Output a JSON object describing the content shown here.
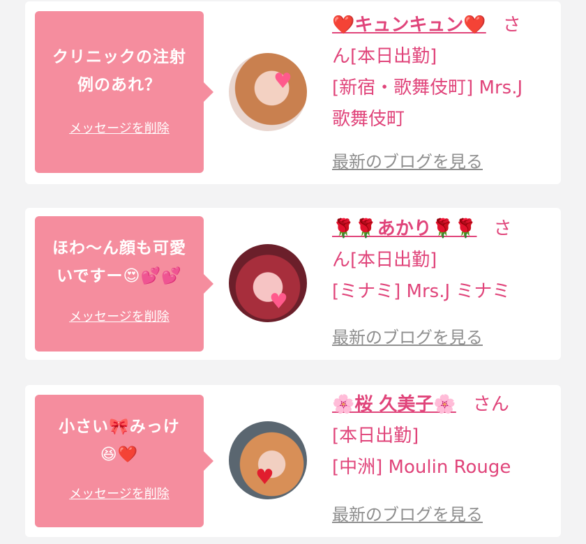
{
  "messages": [
    {
      "message_line1": "クリニックの注射",
      "message_line2": "例のあれ？",
      "delete_label": "メッセージを削除",
      "name": "❤️キュンキュン❤️",
      "honorific": "さ",
      "honorific_rest": "ん[本日出勤]",
      "shop_line1": "[新宿・歌舞伎町] Mrs.J",
      "shop_line2": "歌舞伎町",
      "blog_link": "最新のブログを見る"
    },
    {
      "message_line1": "ほわ〜ん顔も可愛",
      "message_line2": "いですー😍💕💕",
      "delete_label": "メッセージを削除",
      "name": "🌹🌹あかり🌹🌹",
      "honorific": "さ",
      "honorific_rest": "ん[本日出勤]",
      "shop_line1": "[ミナミ] Mrs.J ミナミ",
      "blog_link": "最新のブログを見る"
    },
    {
      "message_line1": "小さい🎀みっけ",
      "message_line2": "😆❤️",
      "delete_label": "メッセージを削除",
      "name": "🌸桜 久美子🌸",
      "honorific": "さん",
      "status": "[本日出勤]",
      "shop_line1": "[中洲] Moulin Rouge",
      "blog_link": "最新のブログを見る"
    }
  ]
}
